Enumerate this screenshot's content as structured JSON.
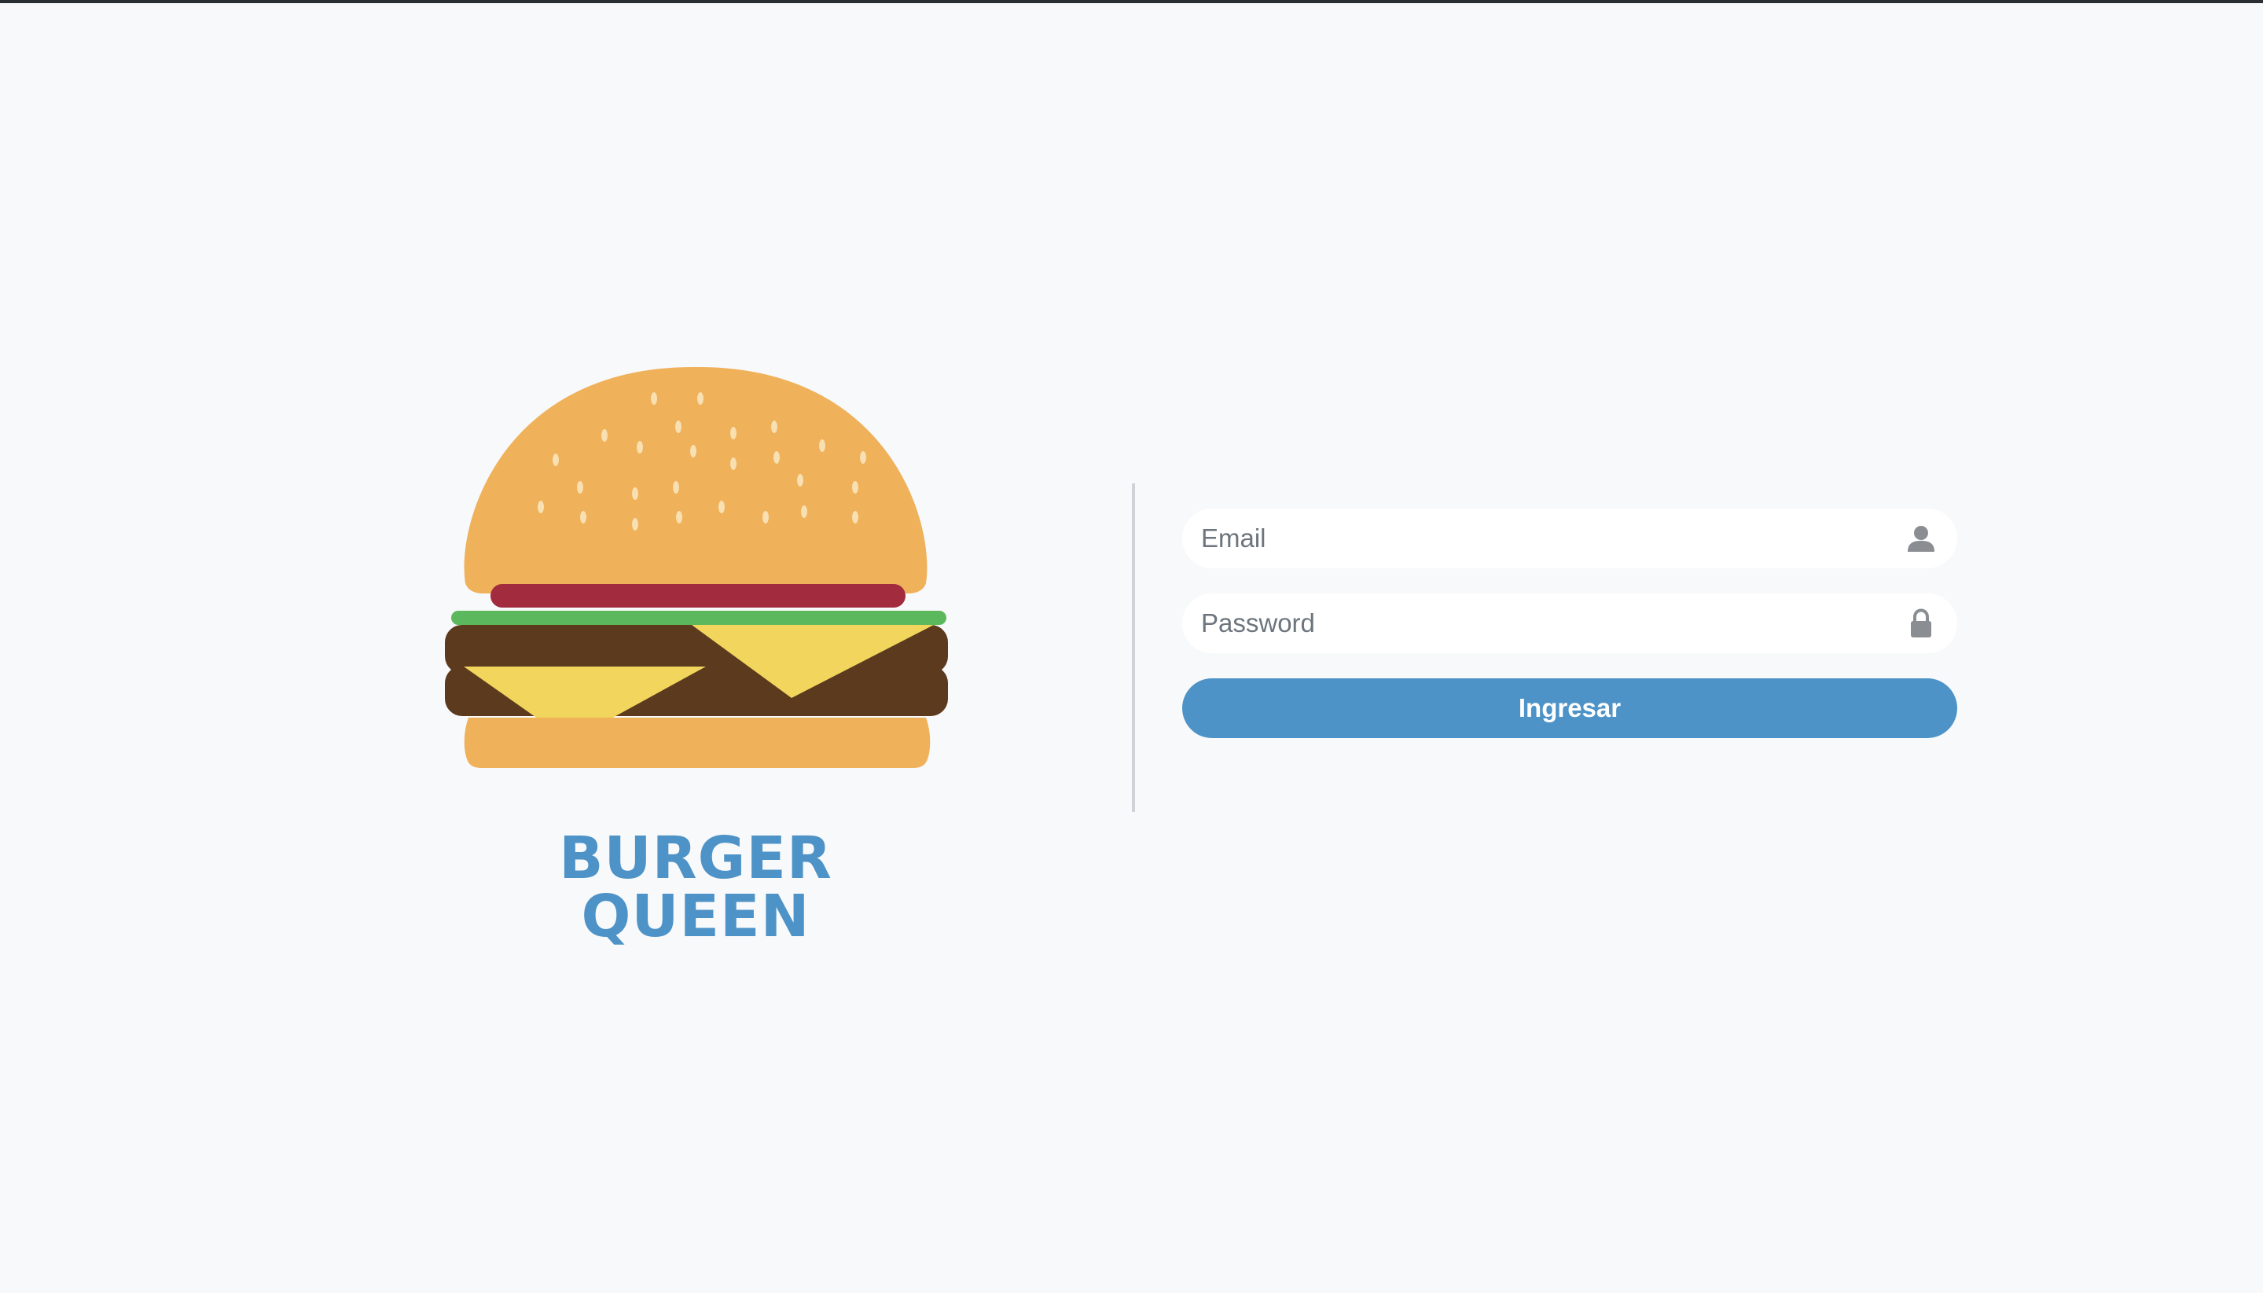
{
  "brand": {
    "name": "BURGER QUEEN",
    "color": "#4e93c7"
  },
  "login": {
    "email": {
      "placeholder": "Email",
      "value": "",
      "icon": "user-icon"
    },
    "password": {
      "placeholder": "Password",
      "value": "",
      "icon": "lock-icon"
    },
    "submit_label": "Ingresar"
  },
  "colors": {
    "background": "#f8f9fa",
    "accent": "#4e93c7",
    "bun": "#efb15a",
    "tomato": "#a22b3e",
    "lettuce": "#5cb85c",
    "patty": "#5b3a1e",
    "cheese": "#f1d55c",
    "icon": "#8a8e92"
  }
}
